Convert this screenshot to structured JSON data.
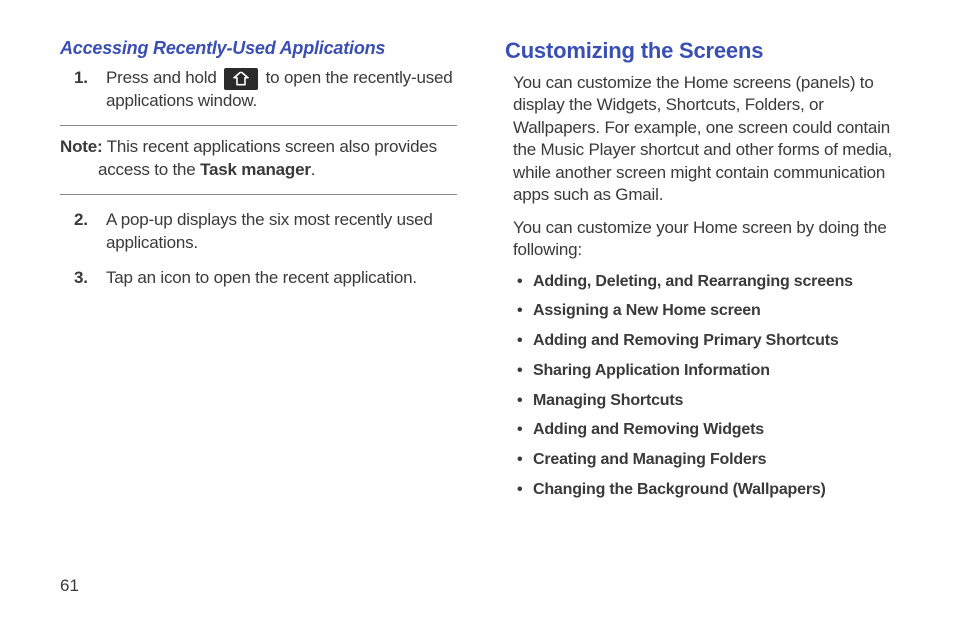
{
  "left": {
    "heading": "Accessing Recently-Used Applications",
    "steps": [
      {
        "num": "1.",
        "before": "Press and hold ",
        "after": " to open the recently-used applications window.",
        "hasIcon": true
      },
      {
        "num": "2.",
        "text": "A pop-up displays the six most recently used applications."
      },
      {
        "num": "3.",
        "text": "Tap an icon to open the recent application."
      }
    ],
    "note": {
      "label": "Note:",
      "text_before": " This recent applications screen also provides access to the ",
      "bold": "Task manager",
      "text_after": "."
    }
  },
  "right": {
    "heading": "Customizing the Screens",
    "para1": "You can customize the Home screens (panels) to display the Widgets, Shortcuts, Folders, or Wallpapers. For example, one screen could contain the Music Player shortcut and other forms of media, while another screen might contain communication apps such as Gmail.",
    "para2": "You can customize your Home screen by doing the following:",
    "bullets": [
      "Adding, Deleting, and Rearranging screens",
      "Assigning a New Home screen",
      "Adding and Removing Primary Shortcuts",
      "Sharing Application Information",
      "Managing Shortcuts",
      "Adding and Removing Widgets",
      "Creating and Managing Folders",
      "Changing the Background (Wallpapers)"
    ]
  },
  "pageNumber": "61"
}
